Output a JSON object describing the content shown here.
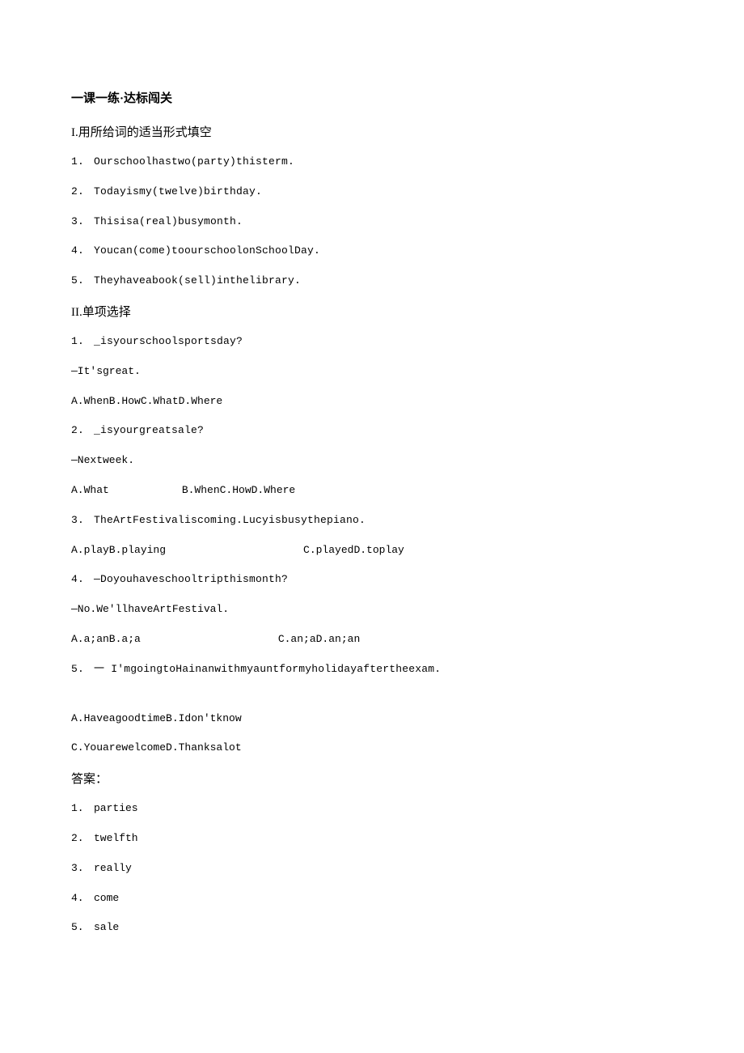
{
  "heading": "一课一练·达标闯关",
  "section1": {
    "roman": "I.",
    "title": "用所给词的适当形式填空",
    "items": [
      {
        "num": "1.",
        "text": "Ourschoolhastwo(party)thisterm."
      },
      {
        "num": "2.",
        "text": "Todayismy(twelve)birthday."
      },
      {
        "num": "3.",
        "text": "Thisisa(real)busymonth."
      },
      {
        "num": "4.",
        "text": "Youcan(come)toourschoolonSchoolDay."
      },
      {
        "num": "5.",
        "text": "Theyhaveabook(sell)inthelibrary."
      }
    ]
  },
  "section2": {
    "roman": "II.",
    "title": "单项选择",
    "q1": {
      "num": "1.",
      "line1": "_isyourschoolsportsday?",
      "line2": "—It'sgreat.",
      "opts": "A.WhenB.HowC.WhatD.Where"
    },
    "q2": {
      "num": "2.",
      "line1": "_isyourgreatsale?",
      "line2": "—Nextweek.",
      "optA": "A.What",
      "optRest": "B.WhenC.HowD.Where"
    },
    "q3": {
      "num": "3.",
      "line1": "TheArtFestivaliscoming.Lucyisbusythepiano.",
      "optsLeft": "A.playB.playing",
      "optsRight": "C.playedD.toplay"
    },
    "q4": {
      "num": "4.",
      "line1": "—Doyouhaveschooltripthismonth?",
      "line2": "—No.We'llhaveArtFestival.",
      "optsLeft": "A.a;anB.a;a",
      "optsRight": "C.an;aD.an;an"
    },
    "q5": {
      "num": "5.",
      "dash": "一",
      "line1": "I'mgoingtoHainanwithmyauntformyholidayaftertheexam.",
      "optsA": "A.HaveagoodtimeB.Idon'tknow",
      "optsB": "C.YouarewelcomeD.Thanksalot"
    }
  },
  "answers": {
    "title": "答案：",
    "items": [
      {
        "num": "1.",
        "text": "parties"
      },
      {
        "num": "2.",
        "text": "twelfth"
      },
      {
        "num": "3.",
        "text": "really"
      },
      {
        "num": "4.",
        "text": "come"
      },
      {
        "num": "5.",
        "text": "sale"
      }
    ]
  }
}
